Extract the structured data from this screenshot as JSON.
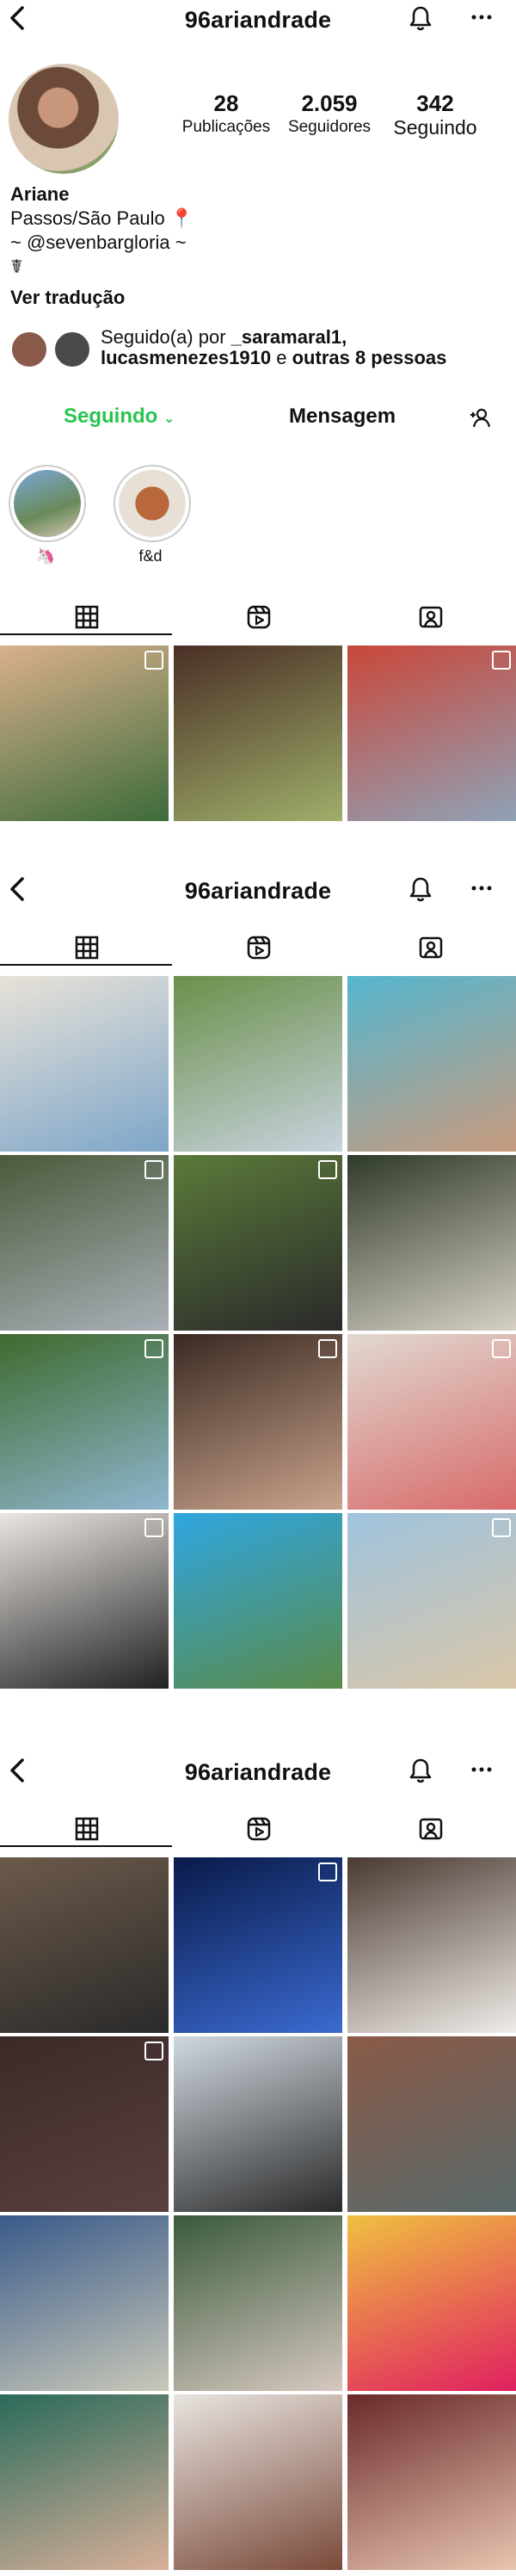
{
  "profile": {
    "username": "96ariandrade",
    "posts": {
      "count": "28",
      "label": "Publicações"
    },
    "followers": {
      "count": "2.059",
      "label": "Seguidores"
    },
    "following": {
      "count": "342",
      "label": "Seguindo"
    },
    "name": "Ariane",
    "location": "Passos/São Paulo 📍",
    "handle_line": "~ @sevenbargloria ~",
    "symbol_line": "☤",
    "see_translation": "Ver tradução",
    "followed_by_prefix": "Seguido(a) por ",
    "followed_by_names": "_saramaral1,",
    "followed_by_line2": "lucasmenezes1910",
    "followed_by_and": " e ",
    "followed_by_others": "outras 8 pessoas",
    "following_button": "Seguindo",
    "message_button": "Mensagem"
  },
  "highlights": [
    {
      "label": "🦄"
    },
    {
      "label": "f&d"
    }
  ],
  "icons": {
    "back": "chevron-left-icon",
    "bell": "bell-icon",
    "more": "more-icon",
    "grid": "grid-icon",
    "reels": "reels-icon",
    "tagged": "tagged-icon",
    "add_user": "add-user-icon"
  },
  "colors": {
    "following_green": "#27c54d"
  },
  "sections": [
    {
      "username": "96ariandrade"
    },
    {
      "username": "96ariandrade"
    }
  ],
  "posts_section1": [
    {
      "c1": "#d9b08c",
      "c2": "#3d6b3a",
      "multi": true
    },
    {
      "c1": "#4a2f26",
      "c2": "#9fae6a",
      "multi": false
    },
    {
      "c1": "#c9473a",
      "c2": "#8fa2b6",
      "multi": true
    }
  ],
  "posts_section2": [
    {
      "c1": "#e8e2d8",
      "c2": "#7ea6c9",
      "multi": false
    },
    {
      "c1": "#6b8f4a",
      "c2": "#c7d3de",
      "multi": false
    },
    {
      "c1": "#55b6cf",
      "c2": "#c79a7e",
      "multi": false
    },
    {
      "c1": "#4a5a3a",
      "c2": "#a9b0b8",
      "multi": true
    },
    {
      "c1": "#5b7a3a",
      "c2": "#2a2a2a",
      "multi": true
    },
    {
      "c1": "#2f3a2a",
      "c2": "#d6d0c6",
      "multi": false
    },
    {
      "c1": "#3f6a2e",
      "c2": "#8fb6cf",
      "multi": true
    },
    {
      "c1": "#3a2a22",
      "c2": "#c9a38c",
      "multi": true
    },
    {
      "c1": "#e0d9d0",
      "c2": "#d86b6b",
      "multi": true
    },
    {
      "c1": "#eae6e2",
      "c2": "#222222",
      "multi": true
    },
    {
      "c1": "#2fa6e0",
      "c2": "#5a8a4a",
      "multi": false
    },
    {
      "c1": "#9fc3dd",
      "c2": "#d9c6a8",
      "multi": true
    }
  ],
  "posts_section3": [
    {
      "c1": "#6c5a4a",
      "c2": "#2a2a2a",
      "multi": false
    },
    {
      "c1": "#0a1a4a",
      "c2": "#3a6ad0",
      "multi": true
    },
    {
      "c1": "#4a3a32",
      "c2": "#f0ece8",
      "multi": false
    },
    {
      "c1": "#3a2a28",
      "c2": "#5a4040",
      "multi": true
    },
    {
      "c1": "#d0d8e0",
      "c2": "#2a2a2a",
      "multi": false
    },
    {
      "c1": "#8a5a48",
      "c2": "#5a6a6a",
      "multi": false
    },
    {
      "c1": "#3a5a8a",
      "c2": "#c8c8b8",
      "multi": false
    },
    {
      "c1": "#3a5a3a",
      "c2": "#d6c8c0",
      "multi": false
    },
    {
      "c1": "#f0c040",
      "c2": "#e02060",
      "multi": false
    },
    {
      "c1": "#2a6a5a",
      "c2": "#d8b09a",
      "multi": false
    },
    {
      "c1": "#e8e4e0",
      "c2": "#7a4a3a",
      "multi": false
    },
    {
      "c1": "#6a2a2a",
      "c2": "#e8c4b0",
      "multi": false
    }
  ]
}
